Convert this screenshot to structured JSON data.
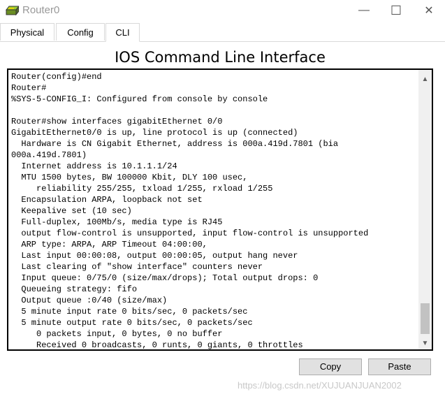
{
  "window": {
    "title": "Router0",
    "minimize_glyph": "—",
    "maximize_glyph": "☐",
    "close_glyph": "✕"
  },
  "tabs": [
    {
      "label": "Physical"
    },
    {
      "label": "Config"
    },
    {
      "label": "CLI"
    }
  ],
  "active_tab": "CLI",
  "heading": "IOS Command Line Interface",
  "console": {
    "lines": [
      "Router(config)#end",
      "Router#",
      "%SYS-5-CONFIG_I: Configured from console by console",
      "",
      "Router#show interfaces gigabitEthernet 0/0",
      "GigabitEthernet0/0 is up, line protocol is up (connected)",
      "  Hardware is CN Gigabit Ethernet, address is 000a.419d.7801 (bia",
      "000a.419d.7801)",
      "  Internet address is 10.1.1.1/24",
      "  MTU 1500 bytes, BW 100000 Kbit, DLY 100 usec,",
      "     reliability 255/255, txload 1/255, rxload 1/255",
      "  Encapsulation ARPA, loopback not set",
      "  Keepalive set (10 sec)",
      "  Full-duplex, 100Mb/s, media type is RJ45",
      "  output flow-control is unsupported, input flow-control is unsupported",
      "  ARP type: ARPA, ARP Timeout 04:00:00,",
      "  Last input 00:00:08, output 00:00:05, output hang never",
      "  Last clearing of \"show interface\" counters never",
      "  Input queue: 0/75/0 (size/max/drops); Total output drops: 0",
      "  Queueing strategy: fifo",
      "  Output queue :0/40 (size/max)",
      "  5 minute input rate 0 bits/sec, 0 packets/sec",
      "  5 minute output rate 0 bits/sec, 0 packets/sec",
      "     0 packets input, 0 bytes, 0 no buffer",
      "     Received 0 broadcasts, 0 runts, 0 giants, 0 throttles"
    ]
  },
  "scrollbar": {
    "up_glyph": "▲",
    "down_glyph": "▼",
    "position_fraction": 0.92
  },
  "buttons": {
    "copy": "Copy",
    "paste": "Paste"
  },
  "watermark": "https://blog.csdn.net/XUJUANJUAN2002"
}
